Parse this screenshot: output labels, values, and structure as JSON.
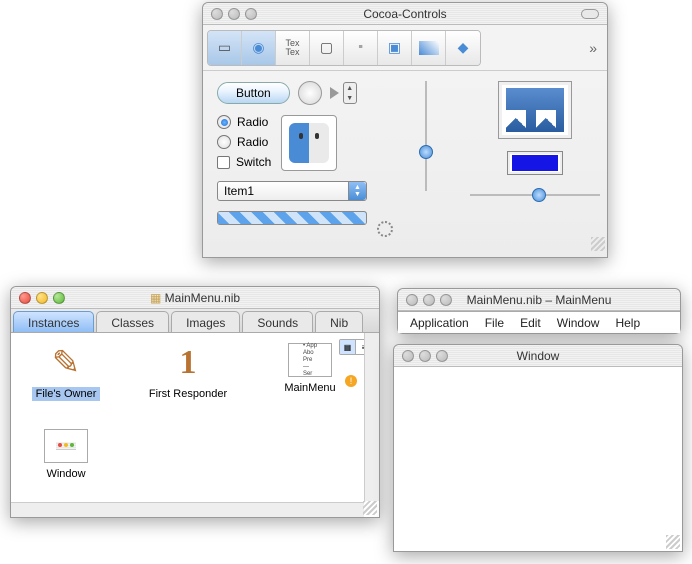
{
  "cocoa": {
    "title": "Cocoa-Controls",
    "toolbar": {
      "items": [
        {
          "name": "views-icon"
        },
        {
          "name": "controls-icon"
        },
        {
          "name": "text-icon",
          "glyph": "Tex"
        },
        {
          "name": "window-icon"
        },
        {
          "name": "formatter-icon"
        },
        {
          "name": "box-icon"
        },
        {
          "name": "table-icon"
        },
        {
          "name": "custom-icon"
        }
      ],
      "selected_index": 1,
      "overflow": "»"
    },
    "button_label": "Button",
    "radio1": "Radio",
    "radio2": "Radio",
    "switch": "Switch",
    "popup_value": "Item1",
    "color": "#1515e6"
  },
  "nib": {
    "title": "MainMenu.nib",
    "tabs": [
      "Instances",
      "Classes",
      "Images",
      "Sounds",
      "Nib"
    ],
    "selected_tab": 0,
    "items": [
      {
        "label": "File's Owner",
        "icon": "owner",
        "selected": true
      },
      {
        "label": "First Responder",
        "icon": "one"
      },
      {
        "label": "MainMenu",
        "icon": "menu",
        "warning": true
      },
      {
        "label": "Window",
        "icon": "window"
      }
    ]
  },
  "menu": {
    "title": "MainMenu.nib – MainMenu",
    "items": [
      "Application",
      "File",
      "Edit",
      "Window",
      "Help"
    ]
  },
  "window": {
    "title": "Window"
  }
}
